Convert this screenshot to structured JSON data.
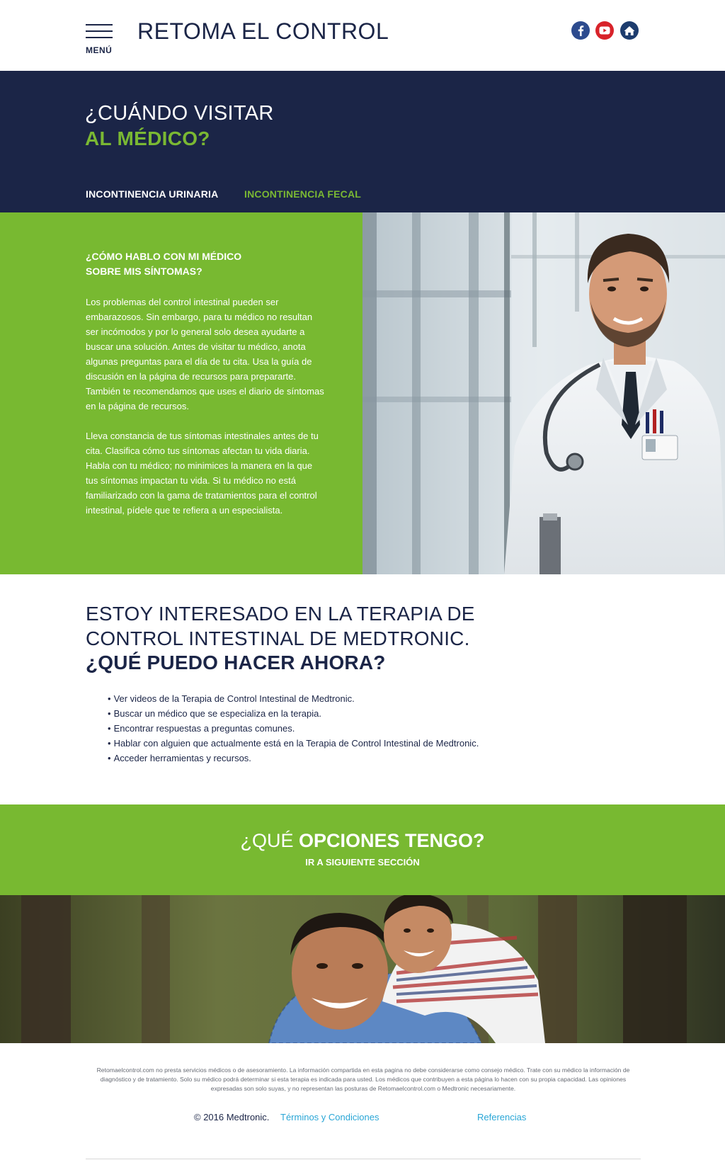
{
  "header": {
    "menu_label": "MENÚ",
    "site_title": "RETOMA EL CONTROL",
    "social": [
      {
        "icon": "facebook-icon",
        "color": "#2d4b8e"
      },
      {
        "icon": "youtube-icon",
        "color": "#d8232a"
      },
      {
        "icon": "home-icon",
        "color": "#1d3c6e"
      }
    ]
  },
  "hero": {
    "title_line1": "¿CUÁNDO VISITAR",
    "title_line2": "AL MÉDICO?",
    "tabs": [
      {
        "label": "INCONTINENCIA URINARIA"
      },
      {
        "label": "INCONTINENCIA FECAL"
      }
    ]
  },
  "talk_section": {
    "title_line1": "¿CÓMO HABLO CON MI MÉDICO",
    "title_line2": "SOBRE MIS SÍNTOMAS?",
    "paragraph1": "Los problemas del control intestinal pueden ser embarazosos. Sin embargo, para tu médico no resultan ser incómodos y por lo general solo desea ayudarte a buscar una solución. Antes de visitar tu médico, anota algunas preguntas para el día de tu cita. Usa la guía de discusión en la página de recursos para prepararte. También te recomendamos que uses el diario de síntomas en la página de recursos.",
    "paragraph2": "Lleva constancia de tus síntomas intestinales antes de tu cita. Clasifica cómo tus síntomas afectan tu vida diaria. Habla con tu médico; no minimices la manera en la que tus síntomas impactan tu vida. Si tu médico no está familiarizado con la gama de tratamientos para el control intestinal, pídele que te refiera a un especialista."
  },
  "interest": {
    "line1": "ESTOY INTERESADO EN LA TERAPIA DE",
    "line2": "CONTROL INTESTINAL DE MEDTRONIC.",
    "line3": "¿QUÉ PUEDO HACER AHORA?",
    "bullets": [
      "Ver videos de la Terapia de Control Intestinal de Medtronic.",
      "Buscar un médico que se especializa en la terapia.",
      "Encontrar respuestas a preguntas comunes.",
      "Hablar con alguien que actualmente está en la Terapia de Control Intestinal de Medtronic.",
      "Acceder herramientas y recursos."
    ]
  },
  "options": {
    "title_light": "¿QUÉ ",
    "title_bold": "OPCIONES TENGO?",
    "subtitle": "IR A SIGUIENTE SECCIÓN"
  },
  "footer": {
    "disclaimer": "Retomaelcontrol.com no presta servicios médicos o de asesoramiento. La información compartida en esta pagina no debe considerarse como consejo médico. Trate con su médico la información de diagnóstico y de tratamiento. Solo su médico podrá determinar si esta terapia es indicada para usted. Los médicos que contribuyen a esta página lo hacen con su propia capacidad. Las opiniones expresadas son solo suyas, y no representan las posturas de Retomaelcontrol.com o Medtronic necesariamente.",
    "copyright": "© 2016 Medtronic.",
    "terms_link": "Términos y Condiciones",
    "references_link": "Referencias"
  },
  "colors": {
    "navy": "#1b2547",
    "green": "#78b931",
    "link": "#29a6d6"
  }
}
